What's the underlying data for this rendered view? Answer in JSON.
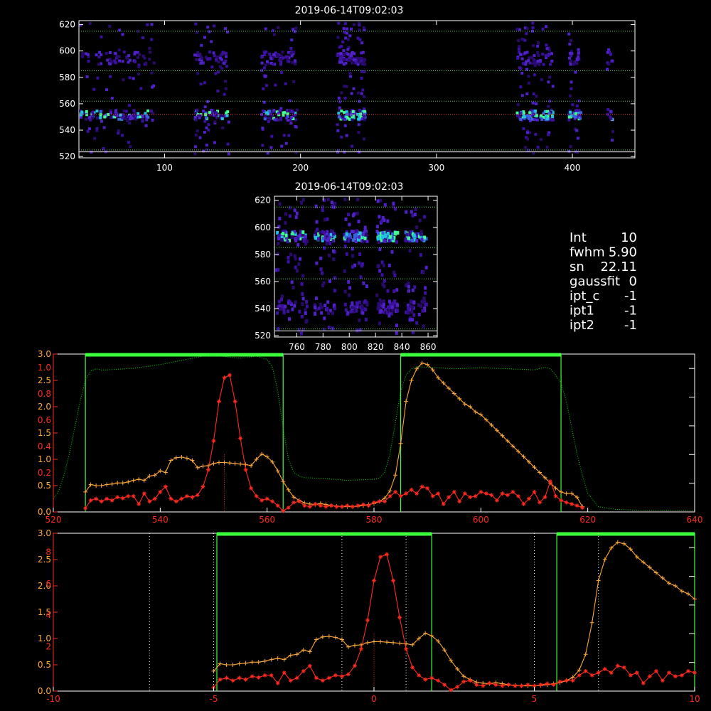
{
  "panels": {
    "top": {
      "title": "2019-06-14T09:02:03",
      "xticks": [
        100,
        200,
        300,
        400
      ],
      "yticks": [
        520,
        540,
        560,
        580,
        600,
        620
      ],
      "xrange": [
        37,
        446
      ],
      "yrange": [
        519,
        623
      ],
      "hlines": [
        615,
        585,
        562,
        552,
        525
      ]
    },
    "zoom": {
      "title": "2019-06-14T09:02:03",
      "xticks": [
        760,
        780,
        800,
        820,
        840,
        860
      ],
      "yticks": [
        520,
        540,
        560,
        580,
        600,
        620
      ],
      "xrange": [
        743,
        867
      ],
      "yrange": [
        519,
        623
      ],
      "hlines": [
        615,
        585,
        562,
        525
      ]
    }
  },
  "info": [
    {
      "key": "Int",
      "value": "10"
    },
    {
      "key": "fwhm",
      "value": "5.90"
    },
    {
      "key": "sn",
      "value": "22.11"
    },
    {
      "key": "gaussfit",
      "value": "0"
    },
    {
      "key": "ipt_c",
      "value": "-1"
    },
    {
      "key": "ipt1",
      "value": "-1"
    },
    {
      "key": "ipt2",
      "value": "-1"
    }
  ],
  "colors": {
    "red": "#ff2b1e",
    "orange": "#ffa838",
    "green": "#00e000",
    "window": "#3cff3c",
    "white": "#ffffff"
  },
  "chart_data": [
    {
      "type": "line",
      "xlim": [
        520,
        640
      ],
      "xticks": [
        520,
        540,
        560,
        580,
        600,
        620,
        640
      ],
      "left_axis_red_ticks": [
        "0.0",
        "0.2",
        "0.4",
        "0.6",
        "0.8",
        "1.0"
      ],
      "left_axis_orange_ticks": [
        "0.0",
        "0.5",
        "1.0",
        "1.5",
        "2.0",
        "2.5",
        "3.0"
      ],
      "ylim_orange": [
        0,
        3.0
      ],
      "windows": [
        [
          526,
          563
        ],
        [
          585,
          615
        ]
      ],
      "center_line": 552,
      "series": [
        {
          "color": "orange",
          "marker": "+",
          "x": [
            526,
            527,
            528,
            529,
            530,
            531,
            532,
            533,
            534,
            535,
            536,
            537,
            538,
            539,
            540,
            541,
            542,
            543,
            544,
            545,
            546,
            547,
            548,
            549,
            550,
            551,
            552,
            553,
            554,
            555,
            556,
            557,
            558,
            559,
            560,
            561,
            562,
            563,
            564,
            565,
            566,
            567,
            568,
            569,
            570,
            571,
            572,
            573,
            574,
            575,
            576,
            577,
            578,
            579,
            580,
            581,
            582,
            583,
            584,
            585,
            586,
            587,
            588,
            589,
            590,
            591,
            592,
            593,
            594,
            595,
            596,
            597,
            598,
            599,
            600,
            601,
            602,
            603,
            604,
            605,
            606,
            607,
            608,
            609,
            610,
            611,
            612,
            613,
            614,
            615,
            616,
            617,
            618,
            619
          ],
          "y": [
            0.38,
            0.52,
            0.5,
            0.5,
            0.52,
            0.53,
            0.55,
            0.55,
            0.57,
            0.6,
            0.62,
            0.6,
            0.68,
            0.7,
            0.78,
            0.75,
            0.98,
            1.03,
            1.04,
            1.02,
            0.98,
            0.84,
            0.87,
            0.88,
            0.92,
            0.94,
            0.94,
            0.93,
            0.92,
            0.91,
            0.9,
            0.88,
            1.0,
            1.1,
            1.05,
            0.95,
            0.78,
            0.58,
            0.42,
            0.28,
            0.22,
            0.17,
            0.15,
            0.14,
            0.16,
            0.14,
            0.12,
            0.11,
            0.1,
            0.1,
            0.1,
            0.11,
            0.12,
            0.14,
            0.16,
            0.2,
            0.26,
            0.4,
            0.7,
            1.3,
            2.1,
            2.5,
            2.72,
            2.83,
            2.8,
            2.7,
            2.55,
            2.45,
            2.35,
            2.25,
            2.15,
            2.05,
            2.0,
            1.9,
            1.85,
            1.75,
            1.65,
            1.55,
            1.45,
            1.35,
            1.25,
            1.15,
            1.05,
            0.95,
            0.85,
            0.75,
            0.65,
            0.55,
            0.45,
            0.38,
            0.35,
            0.35,
            0.28,
            0.1
          ]
        },
        {
          "color": "red",
          "marker": "*",
          "x": [
            526,
            527,
            528,
            529,
            530,
            531,
            532,
            533,
            534,
            535,
            536,
            537,
            538,
            539,
            540,
            541,
            542,
            543,
            544,
            545,
            546,
            547,
            548,
            549,
            550,
            551,
            552,
            553,
            554,
            555,
            556,
            557,
            558,
            559,
            560,
            561,
            562,
            563,
            564,
            565,
            566,
            567,
            568,
            569,
            570,
            571,
            572,
            573,
            574,
            575,
            576,
            577,
            578,
            579,
            580,
            581,
            582,
            583,
            584,
            585,
            586,
            587,
            588,
            589,
            590,
            591,
            592,
            593,
            594,
            595,
            596,
            597,
            598,
            599,
            600,
            601,
            602,
            603,
            604,
            605,
            606,
            607,
            608,
            609,
            610,
            611,
            612,
            613,
            614,
            615,
            616,
            617,
            618,
            619
          ],
          "y": [
            0.07,
            0.22,
            0.25,
            0.2,
            0.25,
            0.22,
            0.28,
            0.26,
            0.3,
            0.3,
            0.15,
            0.35,
            0.2,
            0.25,
            0.38,
            0.48,
            0.25,
            0.2,
            0.25,
            0.3,
            0.28,
            0.32,
            0.48,
            0.8,
            1.35,
            2.1,
            2.55,
            2.6,
            2.1,
            1.4,
            0.8,
            0.45,
            0.3,
            0.22,
            0.25,
            0.2,
            0.12,
            0.02,
            0.08,
            0.18,
            0.2,
            0.12,
            0.1,
            0.15,
            0.12,
            0.1,
            0.12,
            0.1,
            0.1,
            0.12,
            0.1,
            0.12,
            0.14,
            0.12,
            0.18,
            0.2,
            0.2,
            0.3,
            0.38,
            0.3,
            0.35,
            0.42,
            0.35,
            0.48,
            0.45,
            0.3,
            0.35,
            0.15,
            0.28,
            0.38,
            0.2,
            0.35,
            0.28,
            0.3,
            0.38,
            0.35,
            0.32,
            0.22,
            0.35,
            0.32,
            0.38,
            0.3,
            0.15,
            0.25,
            0.38,
            0.18,
            0.28,
            0.58,
            0.3,
            0.22,
            0.18,
            0.15,
            0.12,
            0.08
          ]
        },
        {
          "color": "green",
          "style": "dotted",
          "x": [
            520,
            521,
            522,
            523,
            524,
            525,
            526,
            527,
            528,
            529,
            530,
            535,
            540,
            545,
            548,
            550,
            552,
            555,
            558,
            560,
            561,
            562,
            563,
            564,
            565,
            566,
            567,
            570,
            575,
            580,
            581,
            582,
            583,
            584,
            585,
            586,
            587,
            588,
            590,
            595,
            600,
            605,
            610,
            612,
            613,
            614,
            615,
            616,
            617,
            618,
            619,
            620,
            622,
            625,
            630,
            640
          ],
          "y": [
            0.25,
            0.4,
            0.7,
            1.1,
            1.6,
            2.1,
            2.5,
            2.68,
            2.72,
            2.7,
            2.7,
            2.73,
            2.8,
            2.9,
            2.96,
            2.98,
            2.95,
            2.92,
            2.96,
            2.9,
            2.75,
            2.3,
            1.6,
            1.0,
            0.75,
            0.68,
            0.65,
            0.64,
            0.6,
            0.62,
            0.64,
            0.75,
            1.1,
            1.7,
            2.3,
            2.6,
            2.72,
            2.76,
            2.75,
            2.72,
            2.74,
            2.72,
            2.7,
            2.75,
            2.72,
            2.6,
            2.45,
            2.1,
            1.6,
            1.1,
            0.7,
            0.35,
            0.1,
            0.05,
            0.03,
            0.03
          ]
        }
      ]
    },
    {
      "type": "line",
      "xlim": [
        -10,
        10
      ],
      "xticks": [
        -10,
        -5,
        0,
        5,
        10
      ],
      "left_axis_red_ticks": [
        "0",
        "2",
        "4",
        "6",
        "8"
      ],
      "left_axis_orange_ticks": [
        "0.0",
        "0.5",
        "1.0",
        "1.5",
        "2.0",
        "2.5",
        "3.0"
      ],
      "ylim_orange": [
        0,
        3.0
      ],
      "windows": [
        [
          -4.9,
          1.8
        ],
        [
          5.7,
          10
        ]
      ],
      "dotted_lines": [
        -7.0,
        -5.0,
        -1.0,
        1.0,
        5.0,
        7.0
      ],
      "center_line": 0,
      "series": [
        {
          "color": "orange",
          "marker": "+",
          "x": [
            -5.0,
            -4.8,
            -4.6,
            -4.4,
            -4.2,
            -4.0,
            -3.8,
            -3.6,
            -3.4,
            -3.2,
            -3.0,
            -2.8,
            -2.6,
            -2.4,
            -2.2,
            -2.0,
            -1.8,
            -1.6,
            -1.4,
            -1.2,
            -1.0,
            -0.8,
            -0.6,
            -0.4,
            -0.2,
            0.0,
            0.2,
            0.4,
            0.6,
            0.8,
            1.0,
            1.2,
            1.4,
            1.6,
            1.8,
            2.0,
            2.2,
            2.4,
            2.6,
            2.8,
            3.0,
            3.2,
            3.4,
            3.6,
            3.8,
            4.0,
            4.2,
            4.4,
            4.6,
            4.8,
            5.0,
            5.2,
            5.4,
            5.6,
            5.8,
            6.0,
            6.2,
            6.4,
            6.6,
            6.8,
            7.0,
            7.2,
            7.4,
            7.6,
            7.8,
            8.0,
            8.2,
            8.4,
            8.6,
            8.8,
            9.0,
            9.2,
            9.4,
            9.6,
            9.8,
            10.0
          ],
          "y": [
            0.38,
            0.52,
            0.5,
            0.5,
            0.52,
            0.53,
            0.55,
            0.55,
            0.57,
            0.6,
            0.62,
            0.6,
            0.68,
            0.7,
            0.78,
            0.75,
            0.98,
            1.03,
            1.04,
            1.02,
            0.98,
            0.84,
            0.87,
            0.88,
            0.92,
            0.94,
            0.94,
            0.93,
            0.92,
            0.91,
            0.9,
            0.88,
            1.0,
            1.1,
            1.05,
            0.95,
            0.78,
            0.58,
            0.42,
            0.28,
            0.22,
            0.17,
            0.15,
            0.14,
            0.16,
            0.14,
            0.12,
            0.11,
            0.1,
            0.1,
            0.1,
            0.11,
            0.12,
            0.14,
            0.16,
            0.2,
            0.26,
            0.4,
            0.7,
            1.3,
            2.1,
            2.5,
            2.72,
            2.83,
            2.8,
            2.7,
            2.55,
            2.45,
            2.35,
            2.25,
            2.15,
            2.05,
            2.0,
            1.9,
            1.85,
            1.75
          ]
        },
        {
          "color": "red",
          "marker": "*",
          "x": [
            -5.0,
            -4.8,
            -4.6,
            -4.4,
            -4.2,
            -4.0,
            -3.8,
            -3.6,
            -3.4,
            -3.2,
            -3.0,
            -2.8,
            -2.6,
            -2.4,
            -2.2,
            -2.0,
            -1.8,
            -1.6,
            -1.4,
            -1.2,
            -1.0,
            -0.8,
            -0.6,
            -0.4,
            -0.2,
            0.0,
            0.2,
            0.4,
            0.6,
            0.8,
            1.0,
            1.2,
            1.4,
            1.6,
            1.8,
            2.0,
            2.2,
            2.4,
            2.6,
            2.8,
            3.0,
            3.2,
            3.4,
            3.6,
            3.8,
            4.0,
            4.2,
            4.4,
            4.6,
            4.8,
            5.0,
            5.2,
            5.4,
            5.6,
            5.8,
            6.0,
            6.2,
            6.4,
            6.6,
            6.8,
            7.0,
            7.2,
            7.4,
            7.6,
            7.8,
            8.0,
            8.2,
            8.4,
            8.6,
            8.8,
            9.0,
            9.2,
            9.4,
            9.6,
            9.8,
            10.0
          ],
          "y": [
            0.07,
            0.22,
            0.25,
            0.2,
            0.25,
            0.22,
            0.28,
            0.26,
            0.3,
            0.3,
            0.15,
            0.35,
            0.2,
            0.25,
            0.38,
            0.48,
            0.25,
            0.2,
            0.25,
            0.3,
            0.28,
            0.32,
            0.48,
            0.8,
            1.35,
            2.1,
            2.55,
            2.6,
            2.1,
            1.4,
            0.8,
            0.45,
            0.3,
            0.22,
            0.25,
            0.2,
            0.12,
            0.02,
            0.08,
            0.18,
            0.2,
            0.12,
            0.1,
            0.15,
            0.12,
            0.1,
            0.12,
            0.1,
            0.1,
            0.12,
            0.1,
            0.12,
            0.14,
            0.12,
            0.18,
            0.2,
            0.2,
            0.3,
            0.38,
            0.3,
            0.35,
            0.42,
            0.35,
            0.48,
            0.45,
            0.3,
            0.35,
            0.15,
            0.28,
            0.38,
            0.2,
            0.35,
            0.28,
            0.3,
            0.38,
            0.35
          ]
        }
      ]
    }
  ]
}
